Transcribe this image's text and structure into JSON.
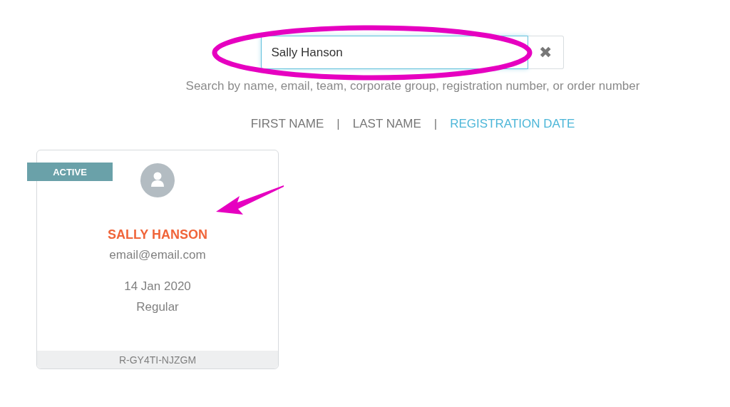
{
  "search": {
    "value": "Sally Hanson",
    "clear_label": "✖",
    "hint": "Search by name, email, team, corporate group, registration number, or order number"
  },
  "sort": [
    {
      "kind": "option",
      "label": "FIRST NAME",
      "selected": false
    },
    {
      "kind": "separator",
      "label": "|"
    },
    {
      "kind": "option",
      "label": "LAST NAME",
      "selected": false
    },
    {
      "kind": "separator",
      "label": "|"
    },
    {
      "kind": "option",
      "label": "REGISTRATION DATE",
      "selected": true
    }
  ],
  "cards": [
    {
      "status": "ACTIVE",
      "name": "SALLY HANSON",
      "email": "email@email.com",
      "date": "14 Jan 2020",
      "type": "Regular",
      "code": "R-GY4TI-NJZGM"
    }
  ]
}
